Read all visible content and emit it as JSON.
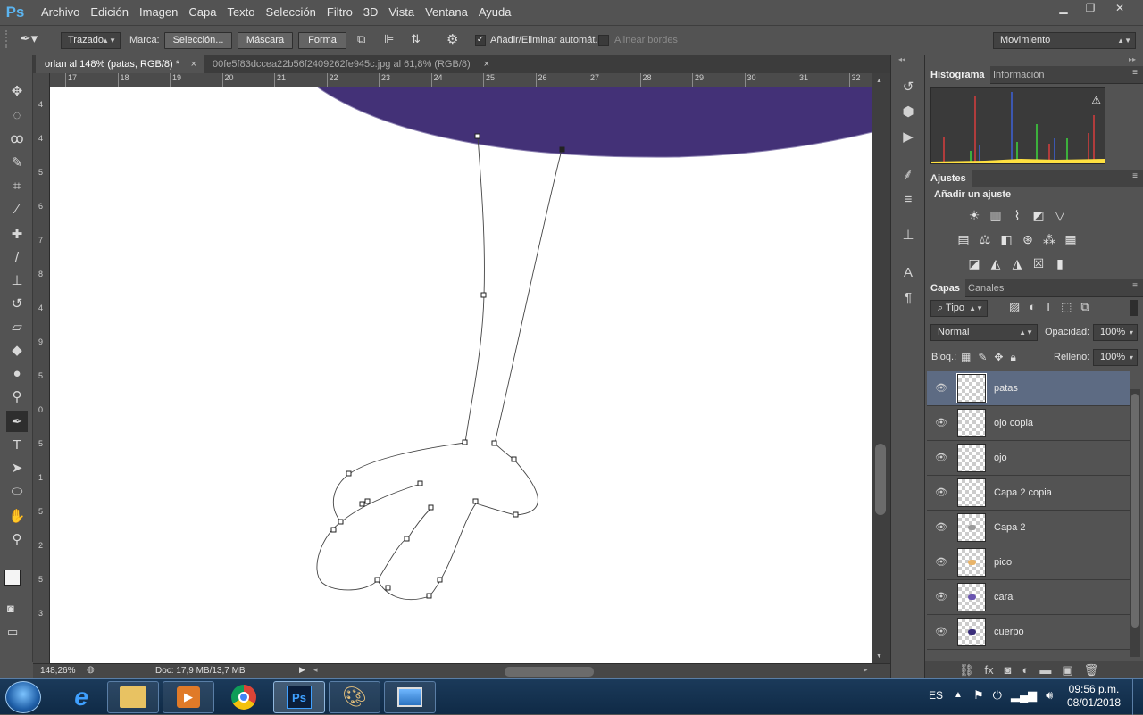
{
  "app": {
    "logo": "Ps"
  },
  "menu": [
    "Archivo",
    "Edición",
    "Imagen",
    "Capa",
    "Texto",
    "Selección",
    "Filtro",
    "3D",
    "Vista",
    "Ventana",
    "Ayuda"
  ],
  "window_controls": [
    "minimize-icon",
    "restore-icon",
    "close-icon"
  ],
  "options": {
    "tool_mode": "Trazado",
    "marca_label": "Marca:",
    "seleccion_btn": "Selección...",
    "mascara_btn": "Máscara",
    "forma_btn": "Forma",
    "auto_add_label": "Añadir/Eliminar automát.",
    "auto_add_checked": true,
    "align_edges_label": "Alinear bordes",
    "align_edges_checked": false,
    "workspace": "Movimiento"
  },
  "tabs": [
    {
      "label": "orlan al 148% (patas, RGB/8) *",
      "active": true
    },
    {
      "label": "00fe5f83dccea22b56f2409262fe945c.jpg al 61,8% (RGB/8)",
      "active": false
    }
  ],
  "tools": [
    "move-tool-icon",
    "marquee-tool-icon",
    "lasso-tool-icon",
    "quick-select-tool-icon",
    "crop-tool-icon",
    "eyedropper-tool-icon",
    "healing-brush-icon",
    "brush-tool-icon",
    "clone-stamp-icon",
    "history-brush-icon",
    "eraser-tool-icon",
    "paint-bucket-icon",
    "blur-tool-icon",
    "dodge-tool-icon",
    "pen-tool-icon",
    "type-tool-icon",
    "path-select-icon",
    "shape-tool-icon",
    "hand-tool-icon",
    "zoom-tool-icon"
  ],
  "rulers": {
    "horizontal": [
      "17",
      "18",
      "19",
      "20",
      "21",
      "22",
      "23",
      "24",
      "25",
      "26",
      "27",
      "28",
      "29",
      "30",
      "31",
      "32"
    ],
    "vertical": [
      "4",
      "4",
      "5",
      "6",
      "7",
      "8",
      "4",
      "9",
      "5",
      "0",
      "5",
      "1",
      "5",
      "2",
      "5",
      "3"
    ]
  },
  "status": {
    "zoom": "148,26%",
    "doc": "Doc: 17,9 MB/13,7 MB"
  },
  "colors": {
    "fill_purple": "#433177",
    "ui_bg": "#535353",
    "selection": "#5d6b83"
  },
  "histogram_panel": {
    "tabs": [
      "Histograma",
      "Información"
    ]
  },
  "adjustments": {
    "tab": "Ajustes",
    "title": "Añadir un ajuste",
    "rows": [
      [
        "brightness-contrast-icon",
        "levels-icon",
        "curves-icon",
        "exposure-icon",
        "vibrance-icon"
      ],
      [
        "hue-saturation-icon",
        "color-balance-icon",
        "black-white-icon",
        "photo-filter-icon",
        "channel-mixer-icon",
        "color-lookup-icon"
      ],
      [
        "invert-icon",
        "posterize-icon",
        "threshold-icon",
        "selective-color-icon",
        "gradient-map-icon"
      ]
    ]
  },
  "layers_panel": {
    "tabs": [
      "Capas",
      "Canales"
    ],
    "filter": "Tipo",
    "blend_mode": "Normal",
    "opacity_label": "Opacidad:",
    "opacity": "100%",
    "lock_label": "Bloq.:",
    "fill_label": "Relleno:",
    "fill": "100%",
    "layers": [
      {
        "name": "patas",
        "selected": true
      },
      {
        "name": "ojo copia",
        "selected": false
      },
      {
        "name": "ojo",
        "selected": false
      },
      {
        "name": "Capa 2 copia",
        "selected": false
      },
      {
        "name": "Capa 2",
        "selected": false
      },
      {
        "name": "pico",
        "selected": false
      },
      {
        "name": "cara",
        "selected": false
      },
      {
        "name": "cuerpo",
        "selected": false
      }
    ],
    "footer_icons": [
      "link-icon",
      "fx-icon",
      "mask-icon",
      "adjustment-layer-icon",
      "group-icon",
      "new-layer-icon",
      "trash-icon"
    ]
  },
  "taskbar": {
    "apps": [
      "start-button",
      "ie-icon",
      "explorer-icon",
      "media-player-icon",
      "chrome-icon",
      "photoshop-icon",
      "paint-icon",
      "photo-viewer-icon"
    ],
    "lang": "ES",
    "time": "09:56 p.m.",
    "date": "08/01/2018"
  }
}
